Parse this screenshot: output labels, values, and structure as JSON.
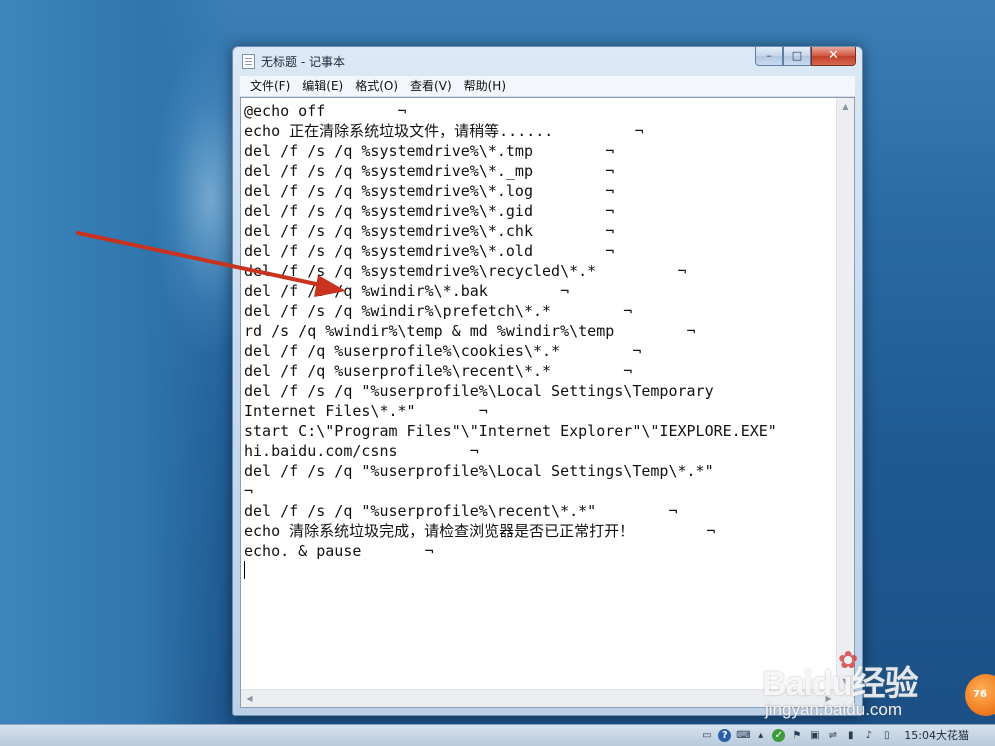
{
  "window": {
    "title": "无标题 - 记事本",
    "controls": {
      "minimize": "–",
      "maximize": "□",
      "close": "✕"
    }
  },
  "menu": [
    "文件(F)",
    "编辑(E)",
    "格式(O)",
    "查看(V)",
    "帮助(H)"
  ],
  "editor": {
    "lines": [
      "@echo off        ¬",
      "echo 正在清除系统垃圾文件，请稍等......         ¬",
      "del /f /s /q %systemdrive%\\*.tmp        ¬",
      "del /f /s /q %systemdrive%\\*._mp        ¬",
      "del /f /s /q %systemdrive%\\*.log        ¬",
      "del /f /s /q %systemdrive%\\*.gid        ¬",
      "del /f /s /q %systemdrive%\\*.chk        ¬",
      "del /f /s /q %systemdrive%\\*.old        ¬",
      "del /f /s /q %systemdrive%\\recycled\\*.*         ¬",
      "del /f /s /q %windir%\\*.bak        ¬",
      "del /f /s /q %windir%\\prefetch\\*.*        ¬",
      "rd /s /q %windir%\\temp & md %windir%\\temp        ¬",
      "del /f /q %userprofile%\\cookies\\*.*        ¬",
      "del /f /q %userprofile%\\recent\\*.*        ¬",
      "del /f /s /q \"%userprofile%\\Local Settings\\Temporary",
      "Internet Files\\*.*\"       ¬",
      "start C:\\\"Program Files\"\\\"Internet Explorer\"\\\"IEXPLORE.EXE\"",
      "hi.baidu.com/csns        ¬",
      "del /f /s /q \"%userprofile%\\Local Settings\\Temp\\*.*\"",
      "¬",
      "del /f /s /q \"%userprofile%\\recent\\*.*\"        ¬",
      "echo 清除系统垃圾完成，请检查浏览器是否已正常打开！        ¬",
      "echo. & pause       ¬"
    ]
  },
  "taskbar": {
    "clock": "15:04大花猫"
  },
  "watermark": {
    "logo": "Baidu经验",
    "url": "jingyan.baidu.com",
    "badge": "76"
  },
  "colors": {
    "annotation_arrow": "#c8321e",
    "desktop": "#2a6aa3"
  }
}
